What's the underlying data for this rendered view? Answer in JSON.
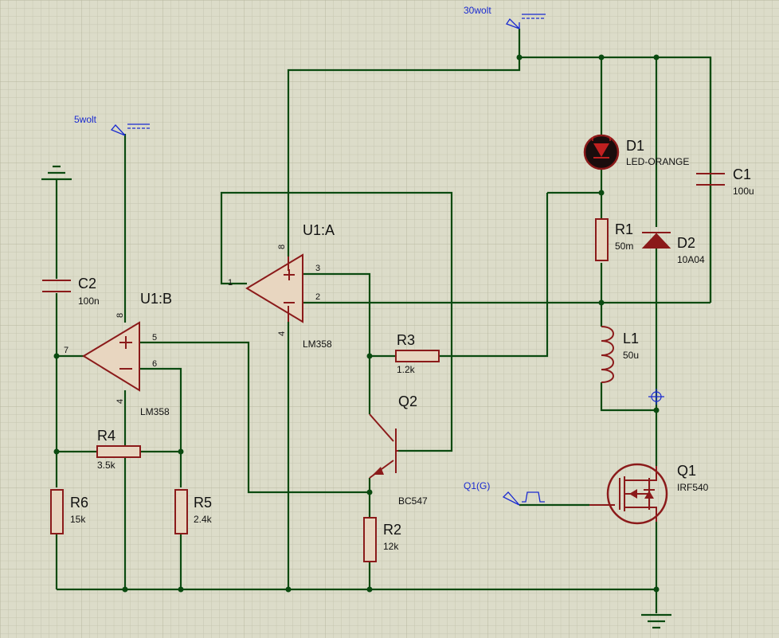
{
  "components": {
    "U1A": {
      "ref": "U1:A",
      "value": "LM358",
      "pin_out": "1",
      "pin_pos": "3",
      "pin_neg": "2",
      "pin_vcc": "8",
      "pin_gnd": "4"
    },
    "U1B": {
      "ref": "U1:B",
      "value": "LM358",
      "pin_out": "7",
      "pin_pos": "5",
      "pin_neg": "6",
      "pin_vcc": "8",
      "pin_gnd": "4"
    },
    "D1": {
      "ref": "D1",
      "value": "LED-ORANGE"
    },
    "D2": {
      "ref": "D2",
      "value": "10A04"
    },
    "R1": {
      "ref": "R1",
      "value": "50m"
    },
    "R2": {
      "ref": "R2",
      "value": "12k"
    },
    "R3": {
      "ref": "R3",
      "value": "1.2k"
    },
    "R4": {
      "ref": "R4",
      "value": "3.5k"
    },
    "R5": {
      "ref": "R5",
      "value": "2.4k"
    },
    "R6": {
      "ref": "R6",
      "value": "15k"
    },
    "C1": {
      "ref": "C1",
      "value": "100u"
    },
    "C2": {
      "ref": "C2",
      "value": "100n"
    },
    "L1": {
      "ref": "L1",
      "value": "50u"
    },
    "Q1": {
      "ref": "Q1",
      "value": "IRF540"
    },
    "Q2": {
      "ref": "Q2",
      "value": "BC547"
    }
  },
  "generators": {
    "supply30": "30wolt",
    "supply5": "5wolt",
    "pulse": "Q1(G)"
  },
  "colors": {
    "wire": "#0a4a10",
    "component": "#8b1a1a",
    "generator": "#1a2ad0",
    "background": "#dcdcc9"
  }
}
